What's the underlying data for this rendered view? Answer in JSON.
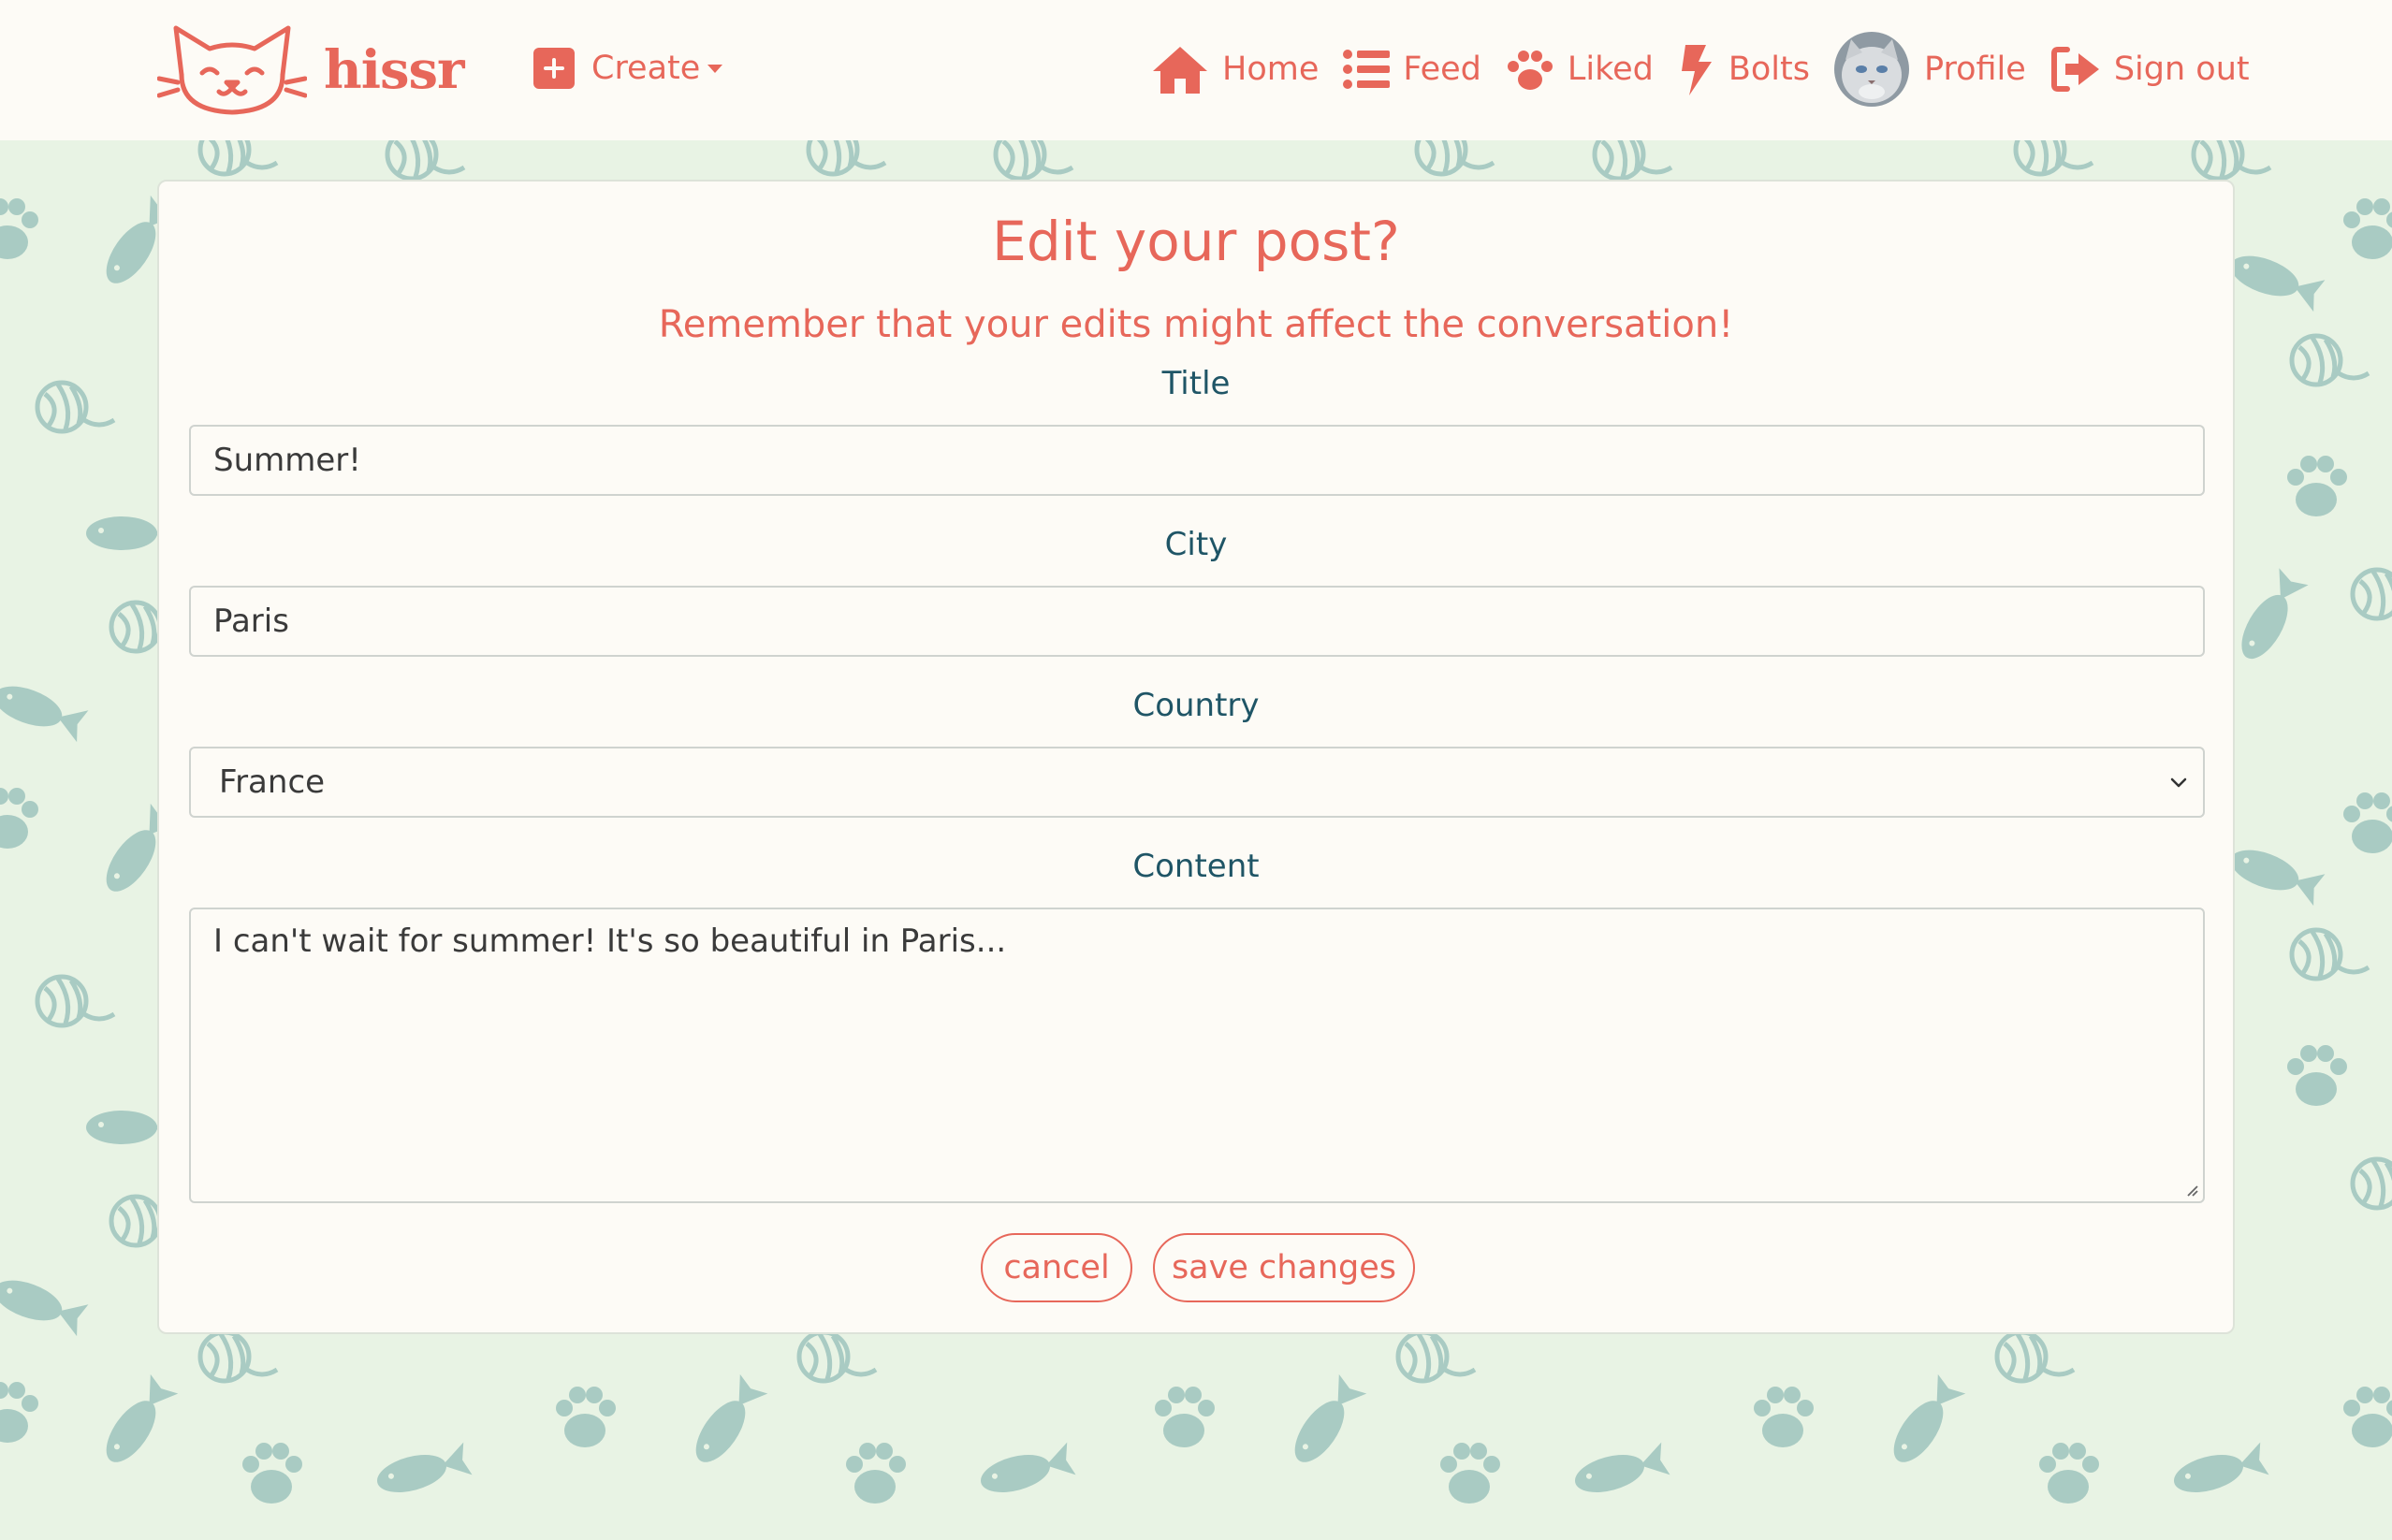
{
  "brand": {
    "name": "hissr"
  },
  "nav": {
    "create_label": "Create",
    "items": [
      {
        "label": "Home",
        "icon": "home-icon"
      },
      {
        "label": "Feed",
        "icon": "list-icon"
      },
      {
        "label": "Liked",
        "icon": "paw-icon"
      },
      {
        "label": "Bolts",
        "icon": "bolt-icon"
      },
      {
        "label": "Profile",
        "icon": "avatar"
      },
      {
        "label": "Sign out",
        "icon": "sign-out-icon"
      }
    ]
  },
  "form": {
    "title": "Edit your post?",
    "subtitle": "Remember that your edits might affect the conversation!",
    "title_label": "Title",
    "title_value": "Summer!",
    "city_label": "City",
    "city_value": "Paris",
    "country_label": "Country",
    "country_value": "France",
    "content_label": "Content",
    "content_value": "I can't wait for summer! It's so beautiful in Paris...",
    "cancel_label": "cancel",
    "save_label": "save changes"
  },
  "colors": {
    "accent": "#e7675a",
    "label": "#1f5566",
    "background": "#e8f3e4",
    "pattern": "#a9cbc3",
    "card": "#fdfbf6"
  }
}
